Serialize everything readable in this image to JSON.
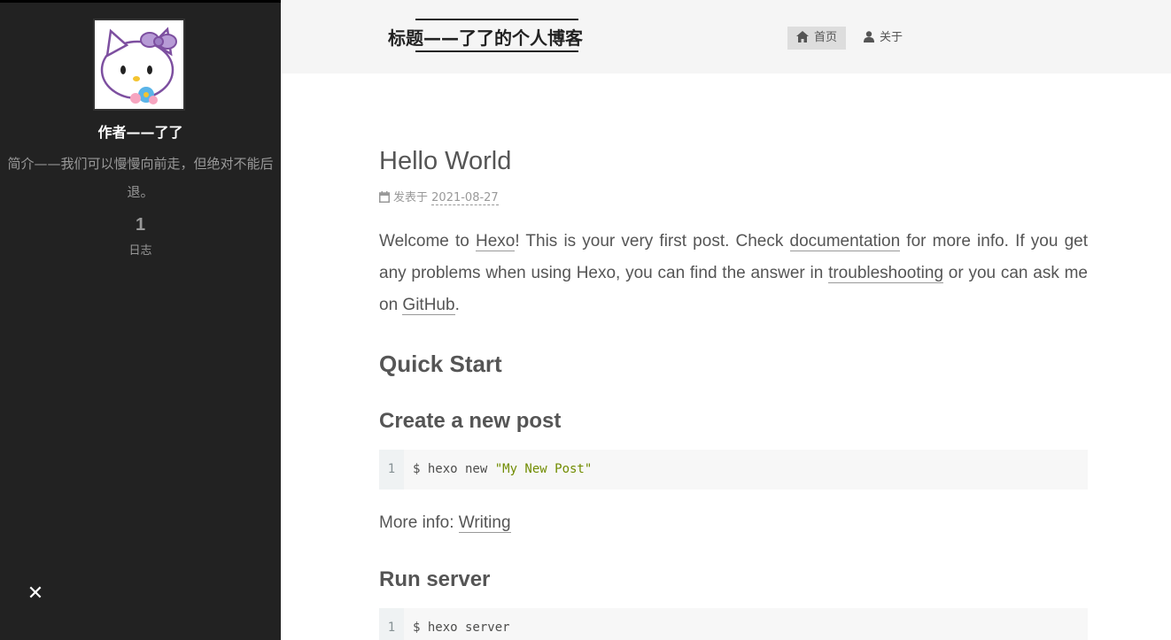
{
  "sidebar": {
    "author_name": "作者——了了",
    "description": "简介——我们可以慢慢向前走，但绝对不能后退。",
    "stats": {
      "posts_count": "1",
      "posts_label": "日志"
    },
    "close_label": "✕"
  },
  "header": {
    "site_title": "标题——了了的个人博客",
    "nav": [
      {
        "label": "首页",
        "icon": "home-icon",
        "active": true
      },
      {
        "label": "关于",
        "icon": "user-icon",
        "active": false
      }
    ]
  },
  "post": {
    "title": "Hello World",
    "meta_label": "发表于",
    "date": "2021-08-27",
    "intro": {
      "t1": "Welcome to ",
      "link1": "Hexo",
      "t2": "! This is your very first post. Check ",
      "link2": "documentation",
      "t3": " for more info. If you get any problems when using Hexo, you can find the answer in ",
      "link3": "troubleshooting",
      "t4": " or you can ask me on ",
      "link4": "GitHub",
      "t5": "."
    },
    "quick_start": "Quick Start",
    "create_post": "Create a new post",
    "code1": {
      "line_no": "1",
      "cmd": "$ hexo new ",
      "arg": "\"My New Post\""
    },
    "more_info_label": "More info: ",
    "more_info_link": "Writing",
    "run_server": "Run server",
    "code2": {
      "line_no": "1",
      "cmd": "$ hexo server"
    }
  },
  "colors": {
    "sidebar_bg": "#222222",
    "header_bg": "#f5f5f5",
    "text": "#555555",
    "code_string": "#718c00"
  }
}
